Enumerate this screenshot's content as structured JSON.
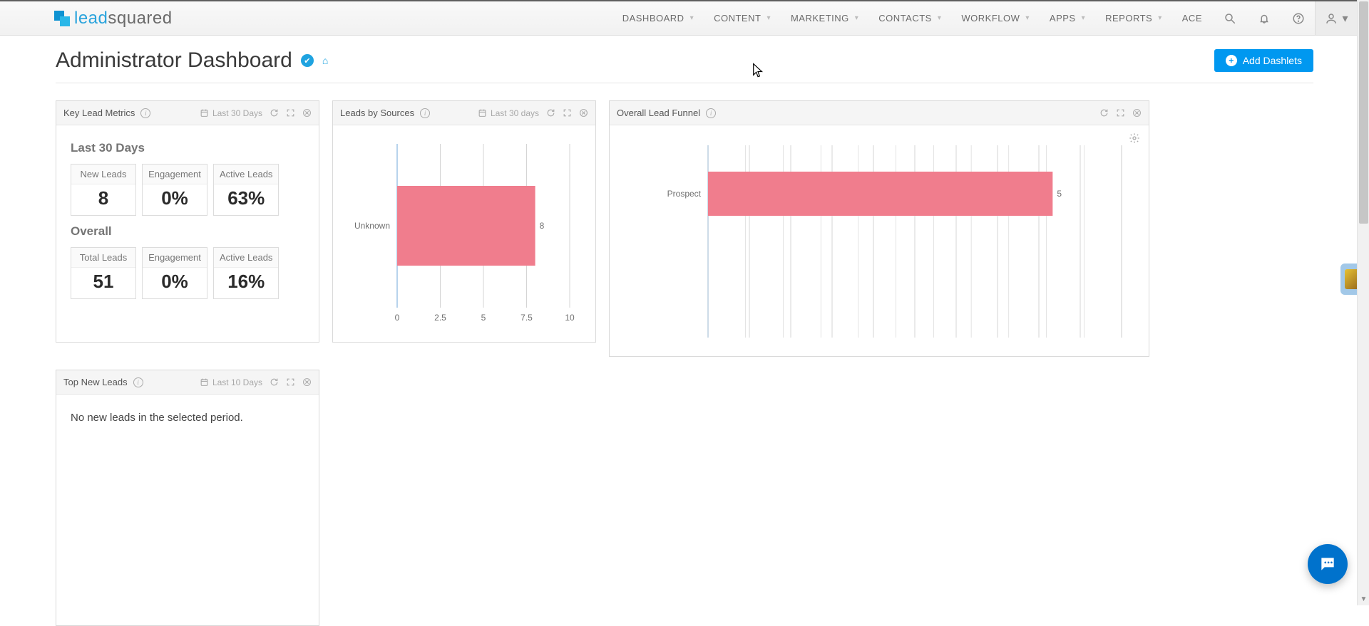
{
  "brand": {
    "lead": "lead",
    "squared": "squared"
  },
  "nav": {
    "items": [
      {
        "label": "DASHBOARD",
        "has_dropdown": true
      },
      {
        "label": "CONTENT",
        "has_dropdown": true
      },
      {
        "label": "MARKETING",
        "has_dropdown": true
      },
      {
        "label": "CONTACTS",
        "has_dropdown": true
      },
      {
        "label": "WORKFLOW",
        "has_dropdown": true
      },
      {
        "label": "APPS",
        "has_dropdown": true
      },
      {
        "label": "REPORTS",
        "has_dropdown": true
      },
      {
        "label": "ACE",
        "has_dropdown": false
      }
    ]
  },
  "page": {
    "title": "Administrator Dashboard",
    "add_dashlets": "Add Dashlets"
  },
  "dashlets": {
    "key_lead_metrics": {
      "title": "Key Lead Metrics",
      "range": "Last 30 Days",
      "sections": {
        "last30": {
          "title": "Last 30 Days",
          "metrics": [
            {
              "label": "New Leads",
              "value": "8"
            },
            {
              "label": "Engagement",
              "value": "0%"
            },
            {
              "label": "Active Leads",
              "value": "63%"
            }
          ]
        },
        "overall": {
          "title": "Overall",
          "metrics": [
            {
              "label": "Total Leads",
              "value": "51"
            },
            {
              "label": "Engagement",
              "value": "0%"
            },
            {
              "label": "Active Leads",
              "value": "16%"
            }
          ]
        }
      }
    },
    "leads_by_sources": {
      "title": "Leads by Sources",
      "range": "Last 30 days"
    },
    "overall_lead_funnel": {
      "title": "Overall Lead Funnel"
    },
    "top_new_leads": {
      "title": "Top New Leads",
      "range": "Last 10 Days",
      "empty": "No new leads in the selected period."
    }
  },
  "chart_data": [
    {
      "id": "leads_by_sources",
      "type": "bar",
      "orientation": "horizontal",
      "categories": [
        "Unknown"
      ],
      "values": [
        8
      ],
      "data_labels": [
        "8"
      ],
      "xlim": [
        0,
        10
      ],
      "x_ticks": [
        0,
        2.5,
        5,
        7.5,
        10
      ],
      "bar_color": "#f07d8d",
      "ylabel": "",
      "xlabel": "",
      "title": ""
    },
    {
      "id": "overall_lead_funnel",
      "type": "bar",
      "orientation": "horizontal",
      "categories": [
        "Prospect"
      ],
      "values": [
        5
      ],
      "data_labels": [
        "5"
      ],
      "xlim": [
        0,
        6
      ],
      "bar_color": "#f07d8d",
      "ylabel": "",
      "xlabel": "",
      "title": ""
    }
  ],
  "colors": {
    "accent": "#0098f0",
    "bar": "#f07d8d"
  }
}
